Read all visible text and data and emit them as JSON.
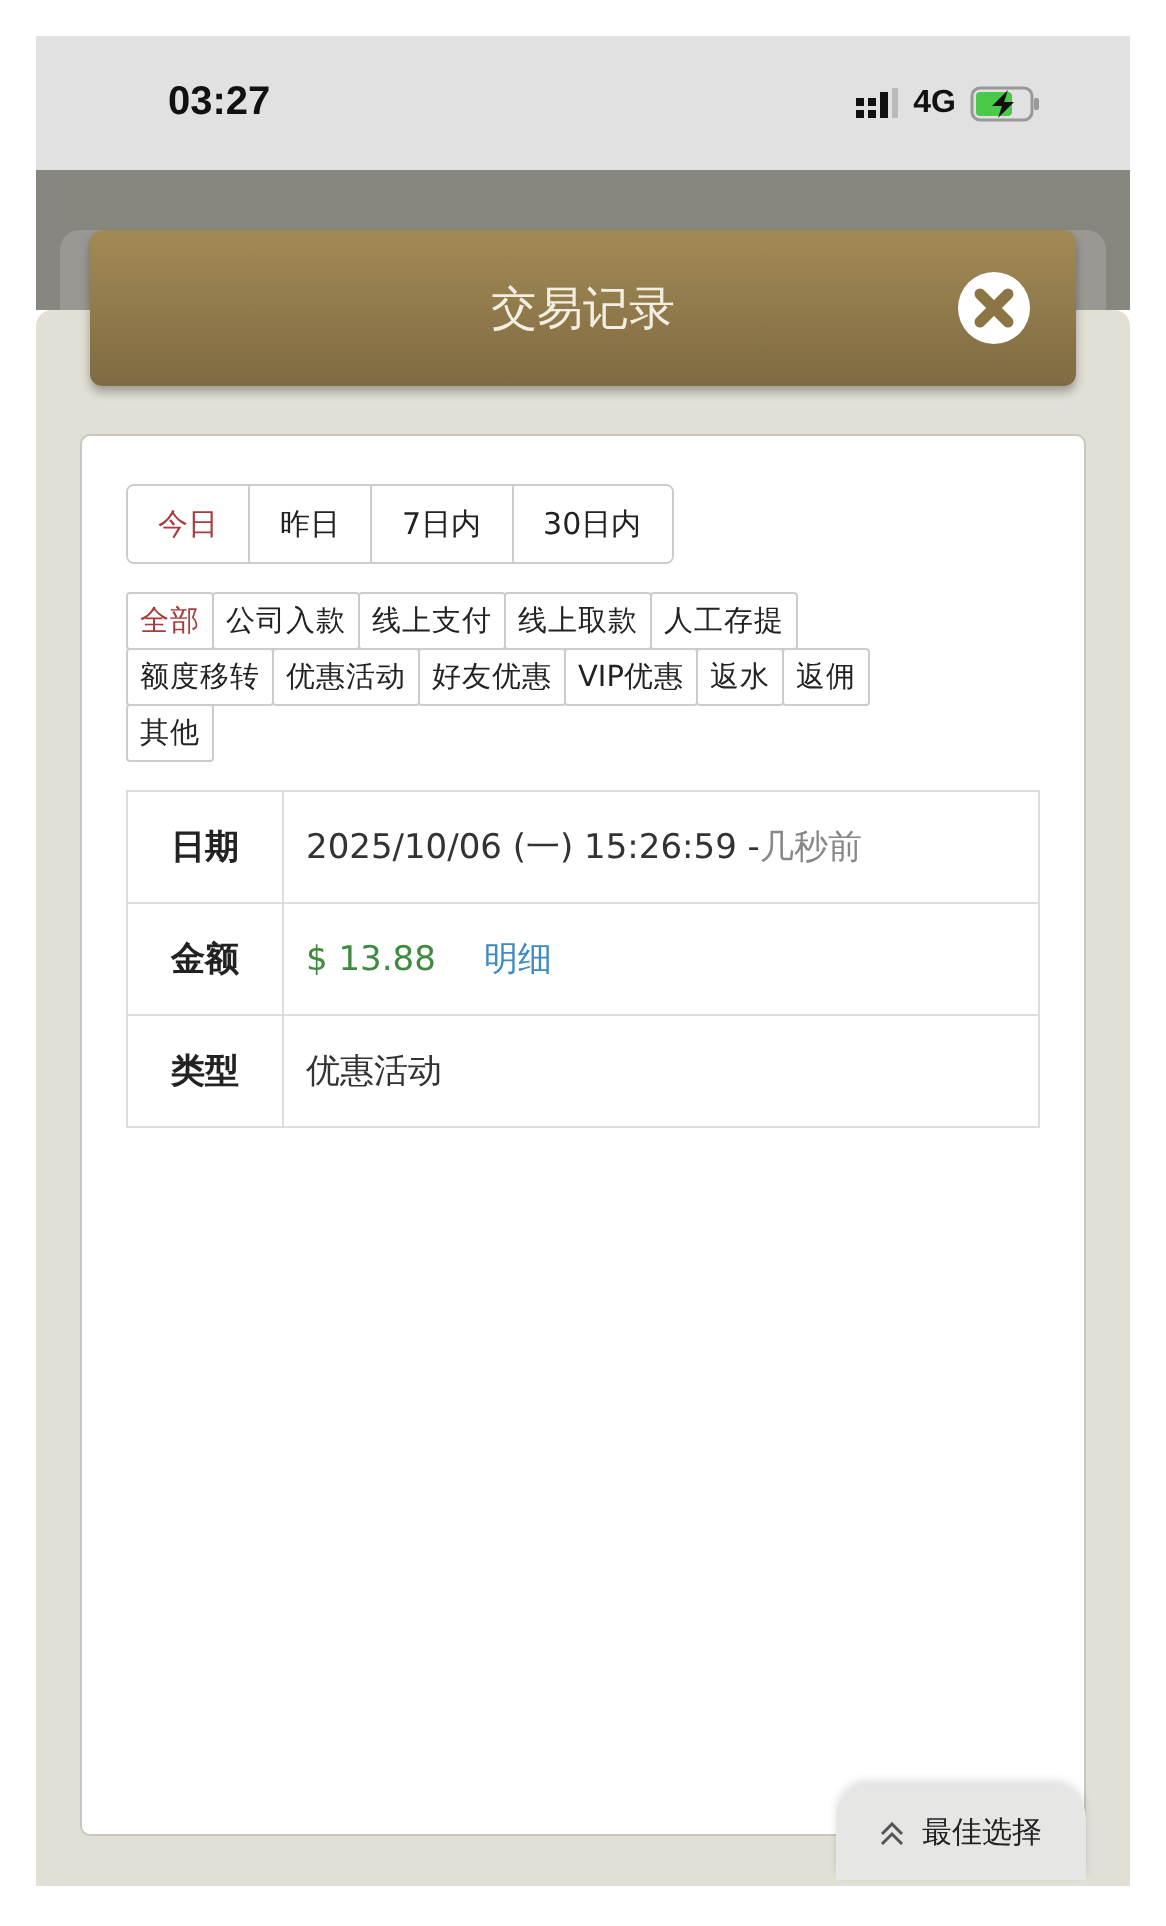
{
  "status_bar": {
    "time": "03:27",
    "network": "4G"
  },
  "dialog": {
    "title": "交易记录"
  },
  "date_tabs": [
    {
      "label": "今日",
      "selected": true
    },
    {
      "label": "昨日",
      "selected": false
    },
    {
      "label": "7日内",
      "selected": false
    },
    {
      "label": "30日内",
      "selected": false
    }
  ],
  "type_filters": [
    {
      "label": "全部",
      "selected": true
    },
    {
      "label": "公司入款",
      "selected": false
    },
    {
      "label": "线上支付",
      "selected": false
    },
    {
      "label": "线上取款",
      "selected": false
    },
    {
      "label": "人工存提",
      "selected": false
    },
    {
      "label": "额度移转",
      "selected": false
    },
    {
      "label": "优惠活动",
      "selected": false
    },
    {
      "label": "好友优惠",
      "selected": false
    },
    {
      "label": "VIP优惠",
      "selected": false
    },
    {
      "label": "返水",
      "selected": false
    },
    {
      "label": "返佣",
      "selected": false
    },
    {
      "label": "其他",
      "selected": false
    }
  ],
  "record": [
    {
      "kind": "date",
      "label": "日期",
      "value": "2025/10/06 (一) 15:26:59 -",
      "ago": "几秒前"
    },
    {
      "kind": "amount",
      "label": "金额",
      "value": "$ 13.88",
      "link": "明细"
    },
    {
      "kind": "text",
      "label": "类型",
      "value": "优惠活动"
    }
  ],
  "bottom_tab": {
    "label": "最佳选择"
  }
}
